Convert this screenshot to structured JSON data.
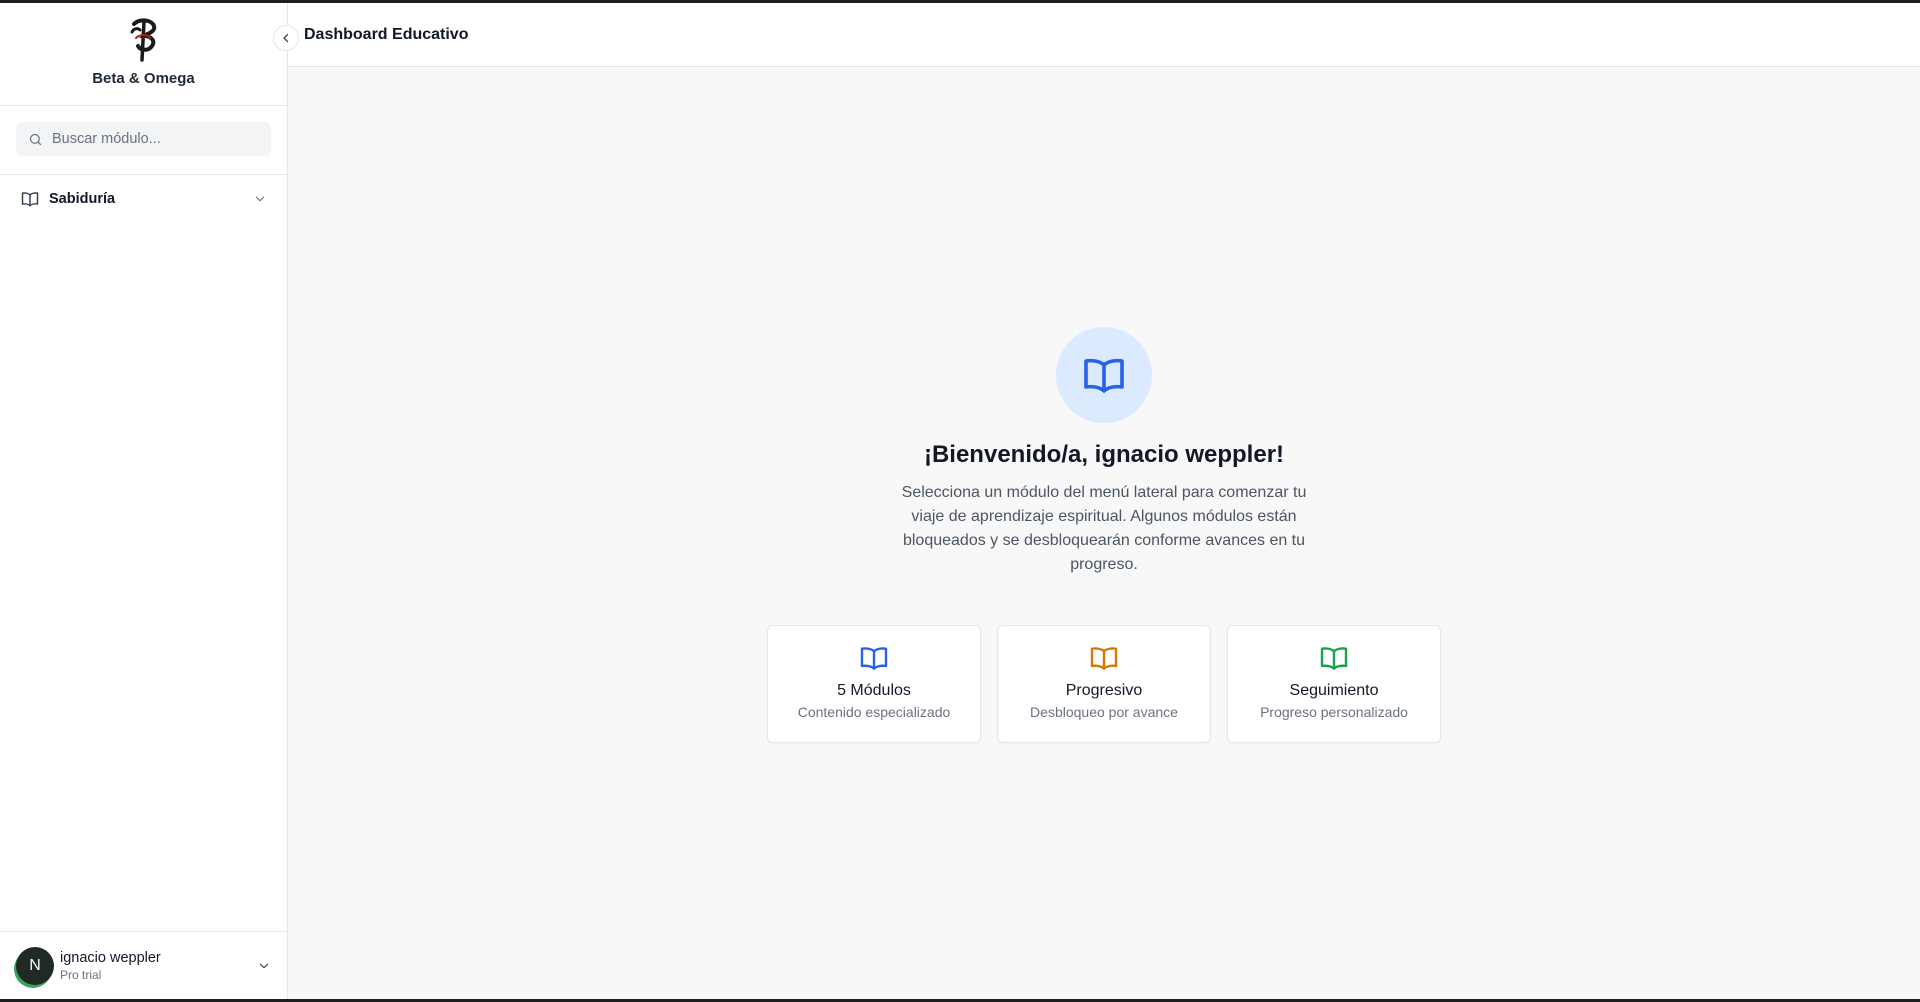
{
  "brand": {
    "name": "Beta & Omega",
    "logo_icon": "brand-logo-glyph"
  },
  "search": {
    "placeholder": "Buscar módulo...",
    "icon": "search-icon"
  },
  "sidebar": {
    "items": [
      {
        "label": "Sabiduría",
        "icon": "book-open-icon",
        "expandable": true
      }
    ]
  },
  "user": {
    "initial": "N",
    "name": "ignacio weppler",
    "plan": "Pro trial"
  },
  "header": {
    "title": "Dashboard Educativo"
  },
  "main": {
    "welcome": "¡Bienvenido/a, ignacio weppler!",
    "intro": "Selecciona un módulo del menú lateral para comenzar tu viaje de aprendizaje espiritual. Algunos módulos están bloqueados y se desbloquearán conforme avances en tu progreso.",
    "cards": [
      {
        "title": "5 Módulos",
        "subtitle": "Contenido especializado",
        "icon": "book-open-icon",
        "color": "#2563eb"
      },
      {
        "title": "Progresivo",
        "subtitle": "Desbloqueo por avance",
        "icon": "book-open-icon",
        "color": "#d97706"
      },
      {
        "title": "Seguimiento",
        "subtitle": "Progreso personalizado",
        "icon": "book-open-icon",
        "color": "#16a34a"
      }
    ]
  },
  "colors": {
    "accent": "#2563eb",
    "accent_soft": "#dbeafe"
  }
}
